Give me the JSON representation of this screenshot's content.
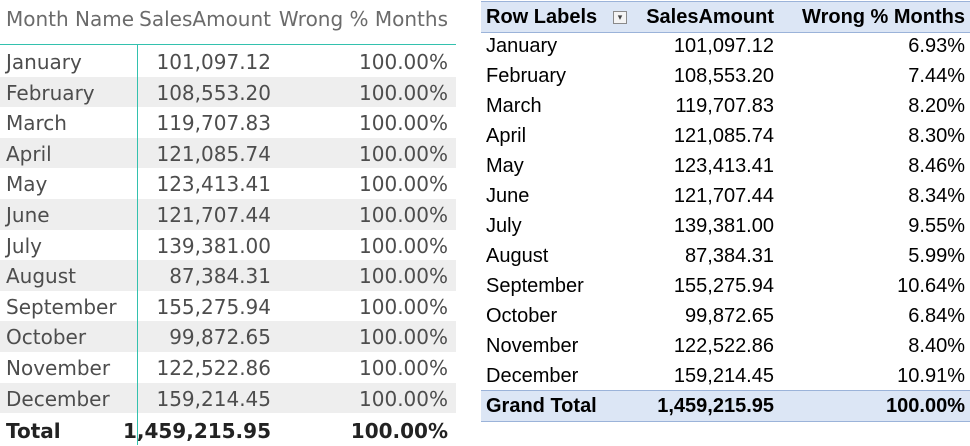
{
  "powerbi_table": {
    "headers": [
      "Month Name",
      "SalesAmount",
      "Wrong % Months"
    ],
    "rows": [
      [
        "January",
        "101,097.12",
        "100.00%"
      ],
      [
        "February",
        "108,553.20",
        "100.00%"
      ],
      [
        "March",
        "119,707.83",
        "100.00%"
      ],
      [
        "April",
        "121,085.74",
        "100.00%"
      ],
      [
        "May",
        "123,413.41",
        "100.00%"
      ],
      [
        "June",
        "121,707.44",
        "100.00%"
      ],
      [
        "July",
        "139,381.00",
        "100.00%"
      ],
      [
        "August",
        "87,384.31",
        "100.00%"
      ],
      [
        "September",
        "155,275.94",
        "100.00%"
      ],
      [
        "October",
        "99,872.65",
        "100.00%"
      ],
      [
        "November",
        "122,522.86",
        "100.00%"
      ],
      [
        "December",
        "159,214.45",
        "100.00%"
      ]
    ],
    "total": [
      "Total",
      "1,459,215.95",
      "100.00%"
    ]
  },
  "excel_pivot": {
    "headers": [
      "Row Labels",
      "SalesAmount",
      "Wrong % Months"
    ],
    "filter_icon": "chevron-down-icon",
    "filter_glyph": "▾",
    "rows": [
      [
        "January",
        "101,097.12",
        "6.93%"
      ],
      [
        "February",
        "108,553.20",
        "7.44%"
      ],
      [
        "March",
        "119,707.83",
        "8.20%"
      ],
      [
        "April",
        "121,085.74",
        "8.30%"
      ],
      [
        "May",
        "123,413.41",
        "8.46%"
      ],
      [
        "June",
        "121,707.44",
        "8.34%"
      ],
      [
        "July",
        "139,381.00",
        "9.55%"
      ],
      [
        "August",
        "87,384.31",
        "5.99%"
      ],
      [
        "September",
        "155,275.94",
        "10.64%"
      ],
      [
        "October",
        "99,872.65",
        "6.84%"
      ],
      [
        "November",
        "122,522.86",
        "8.40%"
      ],
      [
        "December",
        "159,214.45",
        "10.91%"
      ]
    ],
    "total": [
      "Grand Total",
      "1,459,215.95",
      "100.00%"
    ]
  },
  "colors": {
    "pbi_accent": "#33c1ae",
    "pbi_alt_row": "#eeeeee",
    "excel_header_bg": "#dce6f5",
    "excel_border": "#9bb3d9"
  }
}
